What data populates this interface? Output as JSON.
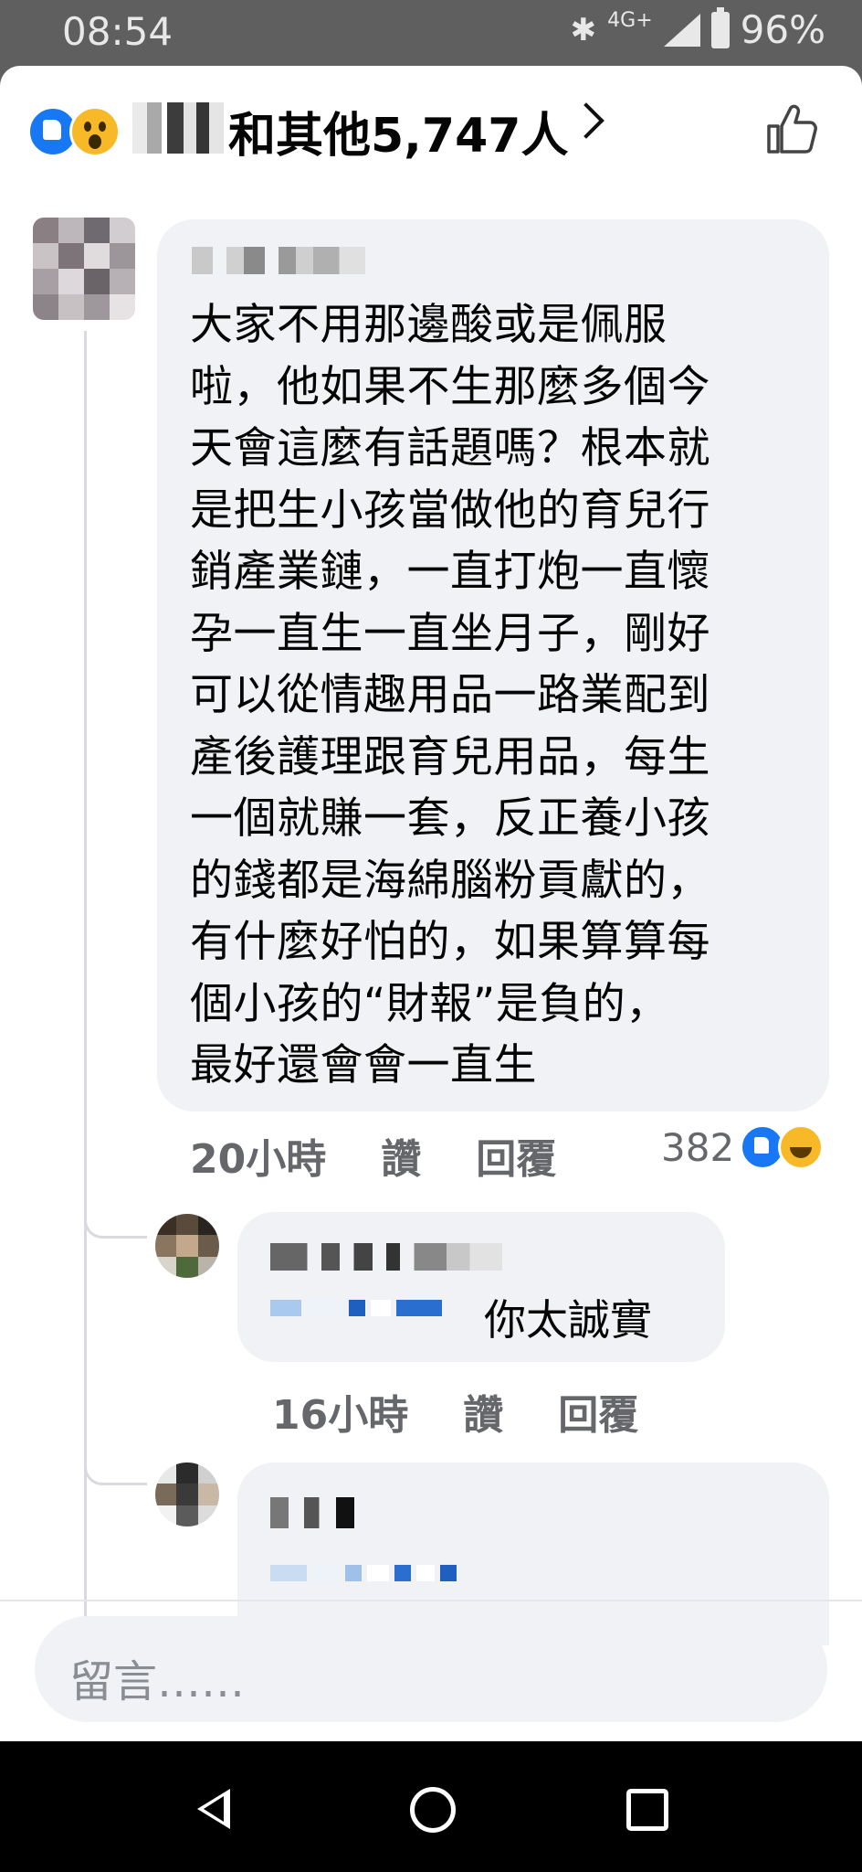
{
  "status_bar": {
    "time": "08:54",
    "network": "4G+",
    "battery": "96%"
  },
  "header": {
    "likes_text": "和其他5,747人",
    "reaction_icons": [
      "like-icon",
      "wow-icon"
    ]
  },
  "comment": {
    "text": "大家不用那邊酸或是佩服\n啦，他如果不生那麼多個今\n天會這麼有話題嗎？根本就\n是把生小孩當做他的育兒行\n銷產業鏈，一直打炮一直懷\n孕一直生一直坐月子，剛好\n可以從情趣用品一路業配到\n產後護理跟育兒用品，每生\n一個就賺一套，反正養小孩\n的錢都是海綿腦粉貢獻的，\n有什麼好怕的，如果算算每\n個小孩的“財報”是負的，\n最好還會會一直生",
    "time": "20小時",
    "like_label": "讚",
    "reply_label": "回覆",
    "reaction_count": "382"
  },
  "reply1": {
    "text": "你太誠實",
    "time": "16小時",
    "like_label": "讚",
    "reply_label": "回覆"
  },
  "composer": {
    "placeholder": "留言……"
  }
}
